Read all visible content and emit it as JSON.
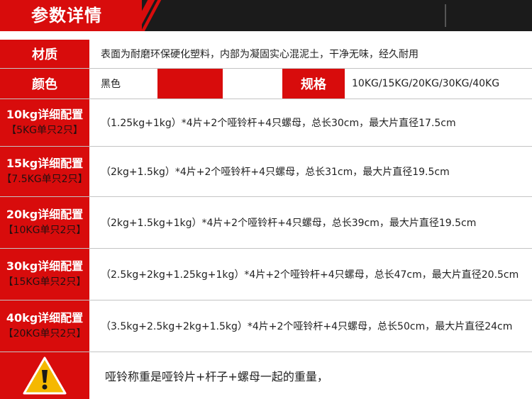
{
  "header": {
    "title": "参数详情"
  },
  "material": {
    "label": "材质",
    "value": "表面为耐磨环保硬化塑料，内部为凝固实心混泥土，干净无味，经久耐用"
  },
  "color": {
    "label": "颜色",
    "value": "黑色"
  },
  "spec": {
    "label": "规格",
    "value": "10KG/15KG/20KG/30KG/40KG"
  },
  "configs": [
    {
      "title": "10kg详细配置",
      "sub": "【5KG单只2只】",
      "value": "（1.25kg+1kg）*4片+2个哑铃杆+4只螺母，总长30cm，最大片直径17.5cm"
    },
    {
      "title": "15kg详细配置",
      "sub": "【7.5KG单只2只】",
      "value": "（2kg+1.5kg）*4片+2个哑铃杆+4只螺母，总长31cm，最大片直径19.5cm"
    },
    {
      "title": "20kg详细配置",
      "sub": "【10KG单只2只】",
      "value": "（2kg+1.5kg+1kg）*4片+2个哑铃杆+4只螺母，总长39cm，最大片直径19.5cm"
    },
    {
      "title": "30kg详细配置",
      "sub": "【15KG单只2只】",
      "value": "（2.5kg+2kg+1.25kg+1kg）*4片+2个哑铃杆+4只螺母，总长47cm，最大片直径20.5cm"
    },
    {
      "title": "40kg详细配置",
      "sub": "【20KG单只2只】",
      "value": "（3.5kg+2.5kg+2kg+1.5kg）*4片+2个哑铃杆+4只螺母，总长50cm，最大片直径24cm"
    }
  ],
  "note": {
    "icon": "warning-icon",
    "text": "哑铃称重是哑铃片+杆子+螺母一起的重量，"
  },
  "colors": {
    "accent": "#d80c0c",
    "header_bg": "#1b1b1b",
    "warning_yellow": "#f5b800"
  }
}
